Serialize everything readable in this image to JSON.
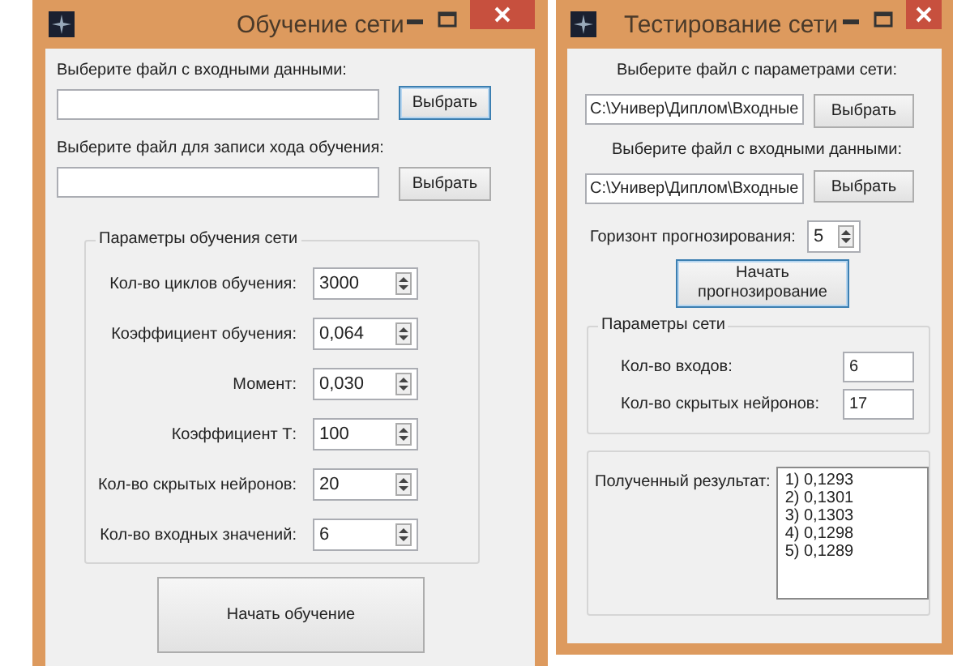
{
  "training_window": {
    "title": "Обучение сети",
    "input_file": {
      "label": "Выберите файл с входными данными:",
      "button": {
        "label": "Выбрать",
        "focused": true
      }
    },
    "log_file": {
      "label": "Выберите файл для записи хода обучения:",
      "button": {
        "label": "Выбрать",
        "focused": false
      }
    },
    "parameters": {
      "title": "Параметры обучения сети",
      "rows": [
        {
          "label": "Кол-во циклов обучения:",
          "value": "3000"
        },
        {
          "label": "Коэффициент обучения:",
          "value": "0,064"
        },
        {
          "label": "Момент:",
          "value": "0,030"
        },
        {
          "label": "Коэффициент Т:",
          "value": "100"
        },
        {
          "label": "Кол-во скрытых нейронов:",
          "value": "20"
        },
        {
          "label": "Кол-во входных значений:",
          "value": "6"
        }
      ]
    },
    "start_button": {
      "label": "Начать обучение",
      "focused": false
    }
  },
  "testing_window": {
    "title": "Тестирование сети",
    "params_file": {
      "label": "Выберите файл с параметрами сети:",
      "value": "C:\\Универ\\Диплом\\Входные",
      "button": {
        "label": "Выбрать",
        "focused": false
      }
    },
    "input_file": {
      "label": "Выберите файл с входными данными:",
      "value": "C:\\Универ\\Диплом\\Входные",
      "button": {
        "label": "Выбрать",
        "focused": false
      }
    },
    "horizon": {
      "label": "Горизонт прогнозирования:",
      "value": "5"
    },
    "start_button": {
      "label": "Начать прогнозирование",
      "focused": true
    },
    "network": {
      "title": "Параметры сети",
      "rows": [
        {
          "label": "Кол-во входов:",
          "value": "6"
        },
        {
          "label": "Кол-во скрытых нейронов:",
          "value": "17"
        }
      ]
    },
    "result": {
      "label": "Полученный результат:",
      "lines": [
        "1) 0,1293",
        "2) 0,1301",
        "3) 0,1303",
        "4) 0,1298",
        "5) 0,1289"
      ]
    }
  }
}
